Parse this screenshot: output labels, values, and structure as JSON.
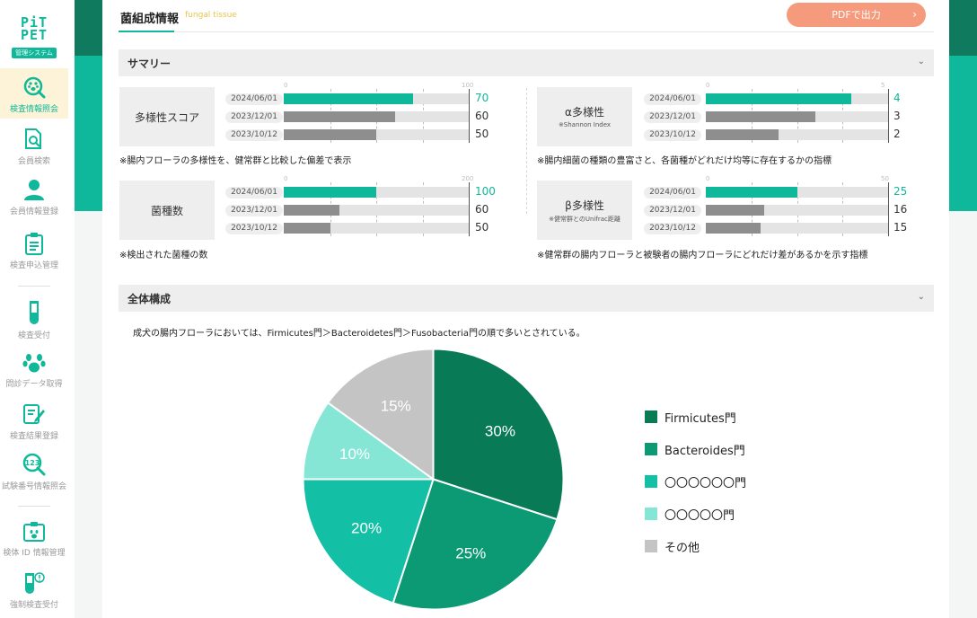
{
  "sidebar": {
    "logo_line1": "PiT",
    "logo_line2": "PET",
    "logo_sub": "管理システム",
    "items": [
      {
        "label": "検査情報照会",
        "icon": "pawprint-search-icon"
      },
      {
        "label": "会員検索",
        "icon": "document-search-icon"
      },
      {
        "label": "会員情報登録",
        "icon": "person-icon"
      },
      {
        "label": "検査申込管理",
        "icon": "clipboard-icon"
      },
      {
        "label": "検査受付",
        "icon": "test-tube-icon"
      },
      {
        "label": "問診データ取得",
        "icon": "paw-icon"
      },
      {
        "label": "検査結果登録",
        "icon": "edit-document-icon"
      },
      {
        "label": "試験番号情報照会",
        "icon": "number-search-icon"
      },
      {
        "label": "検体 ID 情報管理",
        "icon": "id-card-icon"
      },
      {
        "label": "強制検査受付",
        "icon": "test-tube-alert-icon"
      }
    ]
  },
  "header": {
    "title": "菌組成情報",
    "subtitle": "fungal tissue",
    "pdf_button": "PDFで出力"
  },
  "summary": {
    "section_label": "サマリー",
    "metrics": [
      {
        "title": "多様性スコア",
        "sub": "",
        "scale_min": "0",
        "scale_max": "100",
        "max": 100,
        "rows": [
          {
            "date": "2024/06/01",
            "value": 70,
            "value_label": "70"
          },
          {
            "date": "2023/12/01",
            "value": 60,
            "value_label": "60"
          },
          {
            "date": "2023/10/12",
            "value": 50,
            "value_label": "50"
          }
        ],
        "note": "※腸内フローラの多様性を、健常群と比較した偏差で表示"
      },
      {
        "title": "α多様性",
        "sub": "※Shannon Index",
        "scale_min": "0",
        "scale_max": "5",
        "max": 5,
        "rows": [
          {
            "date": "2024/06/01",
            "value": 4,
            "value_label": "4"
          },
          {
            "date": "2023/12/01",
            "value": 3,
            "value_label": "3"
          },
          {
            "date": "2023/10/12",
            "value": 2,
            "value_label": "2"
          }
        ],
        "note": "※腸内細菌の種類の豊富さと、各菌種がどれだけ均等に存在するかの指標"
      },
      {
        "title": "菌種数",
        "sub": "",
        "scale_min": "0",
        "scale_max": "200",
        "max": 200,
        "rows": [
          {
            "date": "2024/06/01",
            "value": 100,
            "value_label": "100"
          },
          {
            "date": "2023/12/01",
            "value": 60,
            "value_label": "60"
          },
          {
            "date": "2023/10/12",
            "value": 50,
            "value_label": "50"
          }
        ],
        "note": "※検出された菌種の数"
      },
      {
        "title": "β多様性",
        "sub": "※健常群とのUnifrac距離",
        "scale_min": "0",
        "scale_max": "50",
        "max": 50,
        "rows": [
          {
            "date": "2024/06/01",
            "value": 25,
            "value_label": "25"
          },
          {
            "date": "2023/12/01",
            "value": 16,
            "value_label": "16"
          },
          {
            "date": "2023/10/12",
            "value": 15,
            "value_label": "15"
          }
        ],
        "note": "※健常群の腸内フローラと被験者の腸内フローラにどれだけ差があるかを示す指標"
      }
    ]
  },
  "composition": {
    "section_label": "全体構成",
    "description": "成犬の腸内フローラにおいては、Firmicutes門＞Bacteroidetes門＞Fusobacteria門の順で多いとされている。"
  },
  "chart_data": {
    "type": "pie",
    "title": "",
    "categories": [
      "Firmicutes門",
      "Bacteroides門",
      "〇〇〇〇〇〇門",
      "〇〇〇〇〇門",
      "その他"
    ],
    "values": [
      30,
      25,
      20,
      10,
      15
    ],
    "value_labels": [
      "30%",
      "25%",
      "20%",
      "10%",
      "15%"
    ],
    "colors": [
      "#087a56",
      "#0b9a74",
      "#13c0a5",
      "#86e6d6",
      "#c4c4c4"
    ],
    "legend_position": "right"
  }
}
